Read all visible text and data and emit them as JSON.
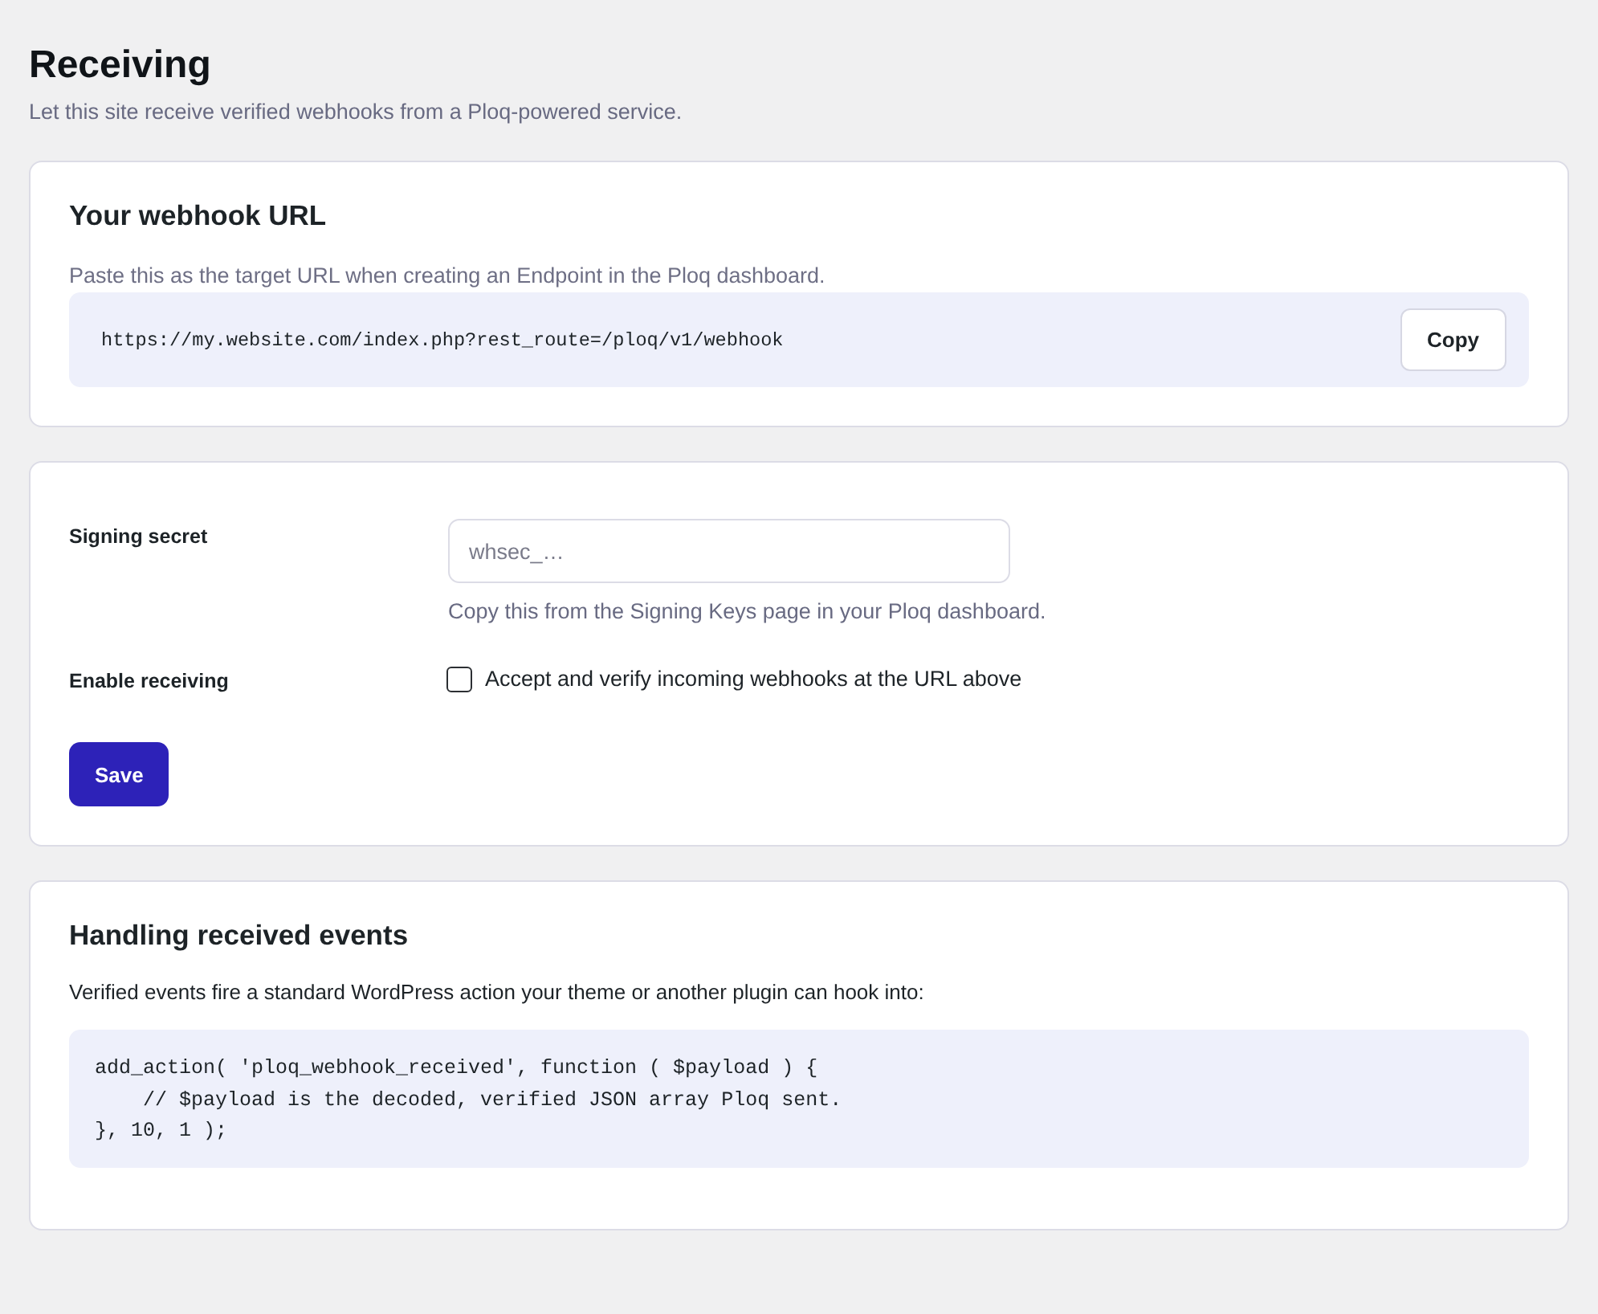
{
  "page": {
    "title": "Receiving",
    "subtitle": "Let this site receive verified webhooks from a Ploq-powered service."
  },
  "webhook_url_card": {
    "heading": "Your webhook URL",
    "description": "Paste this as the target URL when creating an Endpoint in the Ploq dashboard.",
    "url": "https://my.website.com/index.php?rest_route=/ploq/v1/webhook",
    "copy_button": "Copy"
  },
  "settings_card": {
    "fields": [
      {
        "kind": "text",
        "label": "Signing secret",
        "placeholder": "whsec_…",
        "help": "Copy this from the Signing Keys page in your Ploq dashboard."
      },
      {
        "kind": "checkbox",
        "label": "Enable receiving",
        "option_label": "Accept and verify incoming webhooks at the URL above",
        "checked": false
      }
    ],
    "save_button": "Save"
  },
  "events_card": {
    "heading": "Handling received events",
    "description": "Verified events fire a standard WordPress action your theme or another plugin can hook into:",
    "code_lines": [
      "add_action( 'ploq_webhook_received', function ( $payload ) {",
      "    // $payload is the decoded, verified JSON array Ploq sent.",
      "}, 10, 1 );"
    ]
  }
}
